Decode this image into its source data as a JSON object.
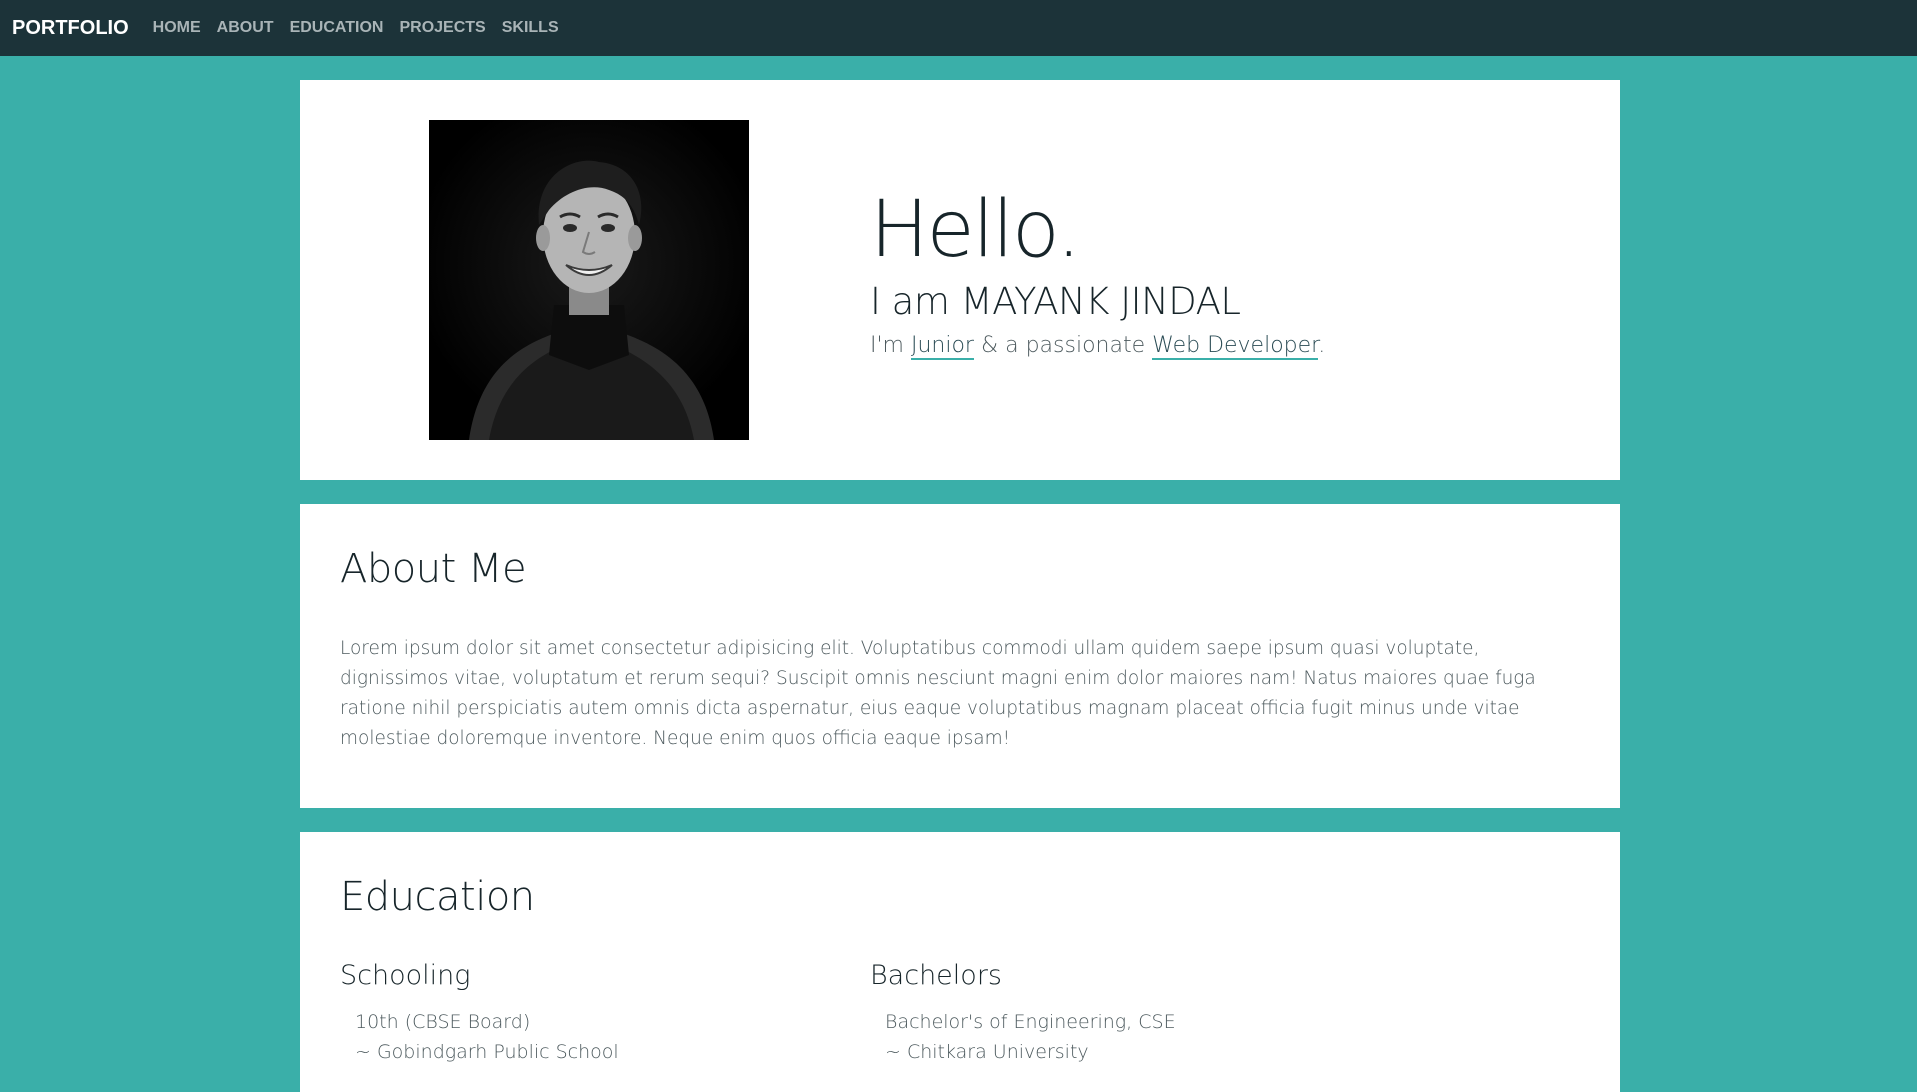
{
  "nav": {
    "brand": "PORTFOLIO",
    "links": [
      "HOME",
      "ABOUT",
      "EDUCATION",
      "PROJECTS",
      "SKILLS"
    ]
  },
  "hero": {
    "greeting": "Hello.",
    "intro": "I am MAYANK JINDAL",
    "tagline_prefix": "I'm ",
    "tagline_highlight_1": "Junior",
    "tagline_middle": " & a passionate ",
    "tagline_highlight_2": "Web Developer",
    "tagline_suffix": "."
  },
  "about": {
    "title": "About Me",
    "body": "Lorem ipsum dolor sit amet consectetur adipisicing elit. Voluptatibus commodi ullam quidem saepe ipsum quasi voluptate, dignissimos vitae, voluptatum et rerum sequi? Suscipit omnis nesciunt magni enim dolor maiores nam! Natus maiores quae fuga ratione nihil perspiciatis autem omnis dicta aspernatur, eius eaque voluptatibus magnam placeat officia fugit minus unde vitae molestiae doloremque inventore. Neque enim quos officia eaque ipsam!"
  },
  "education": {
    "title": "Education",
    "schooling": {
      "heading": "Schooling",
      "line1": "10th (CBSE Board)",
      "line2": "~ Gobindgarh Public School"
    },
    "bachelors": {
      "heading": "Bachelors",
      "line1": "Bachelor's of Engineering, CSE",
      "line2": "~ Chitkara University"
    }
  },
  "colors": {
    "background": "#3aafa9",
    "navbar": "#1c3339",
    "card": "#ffffff",
    "accent": "#3aafa9"
  }
}
